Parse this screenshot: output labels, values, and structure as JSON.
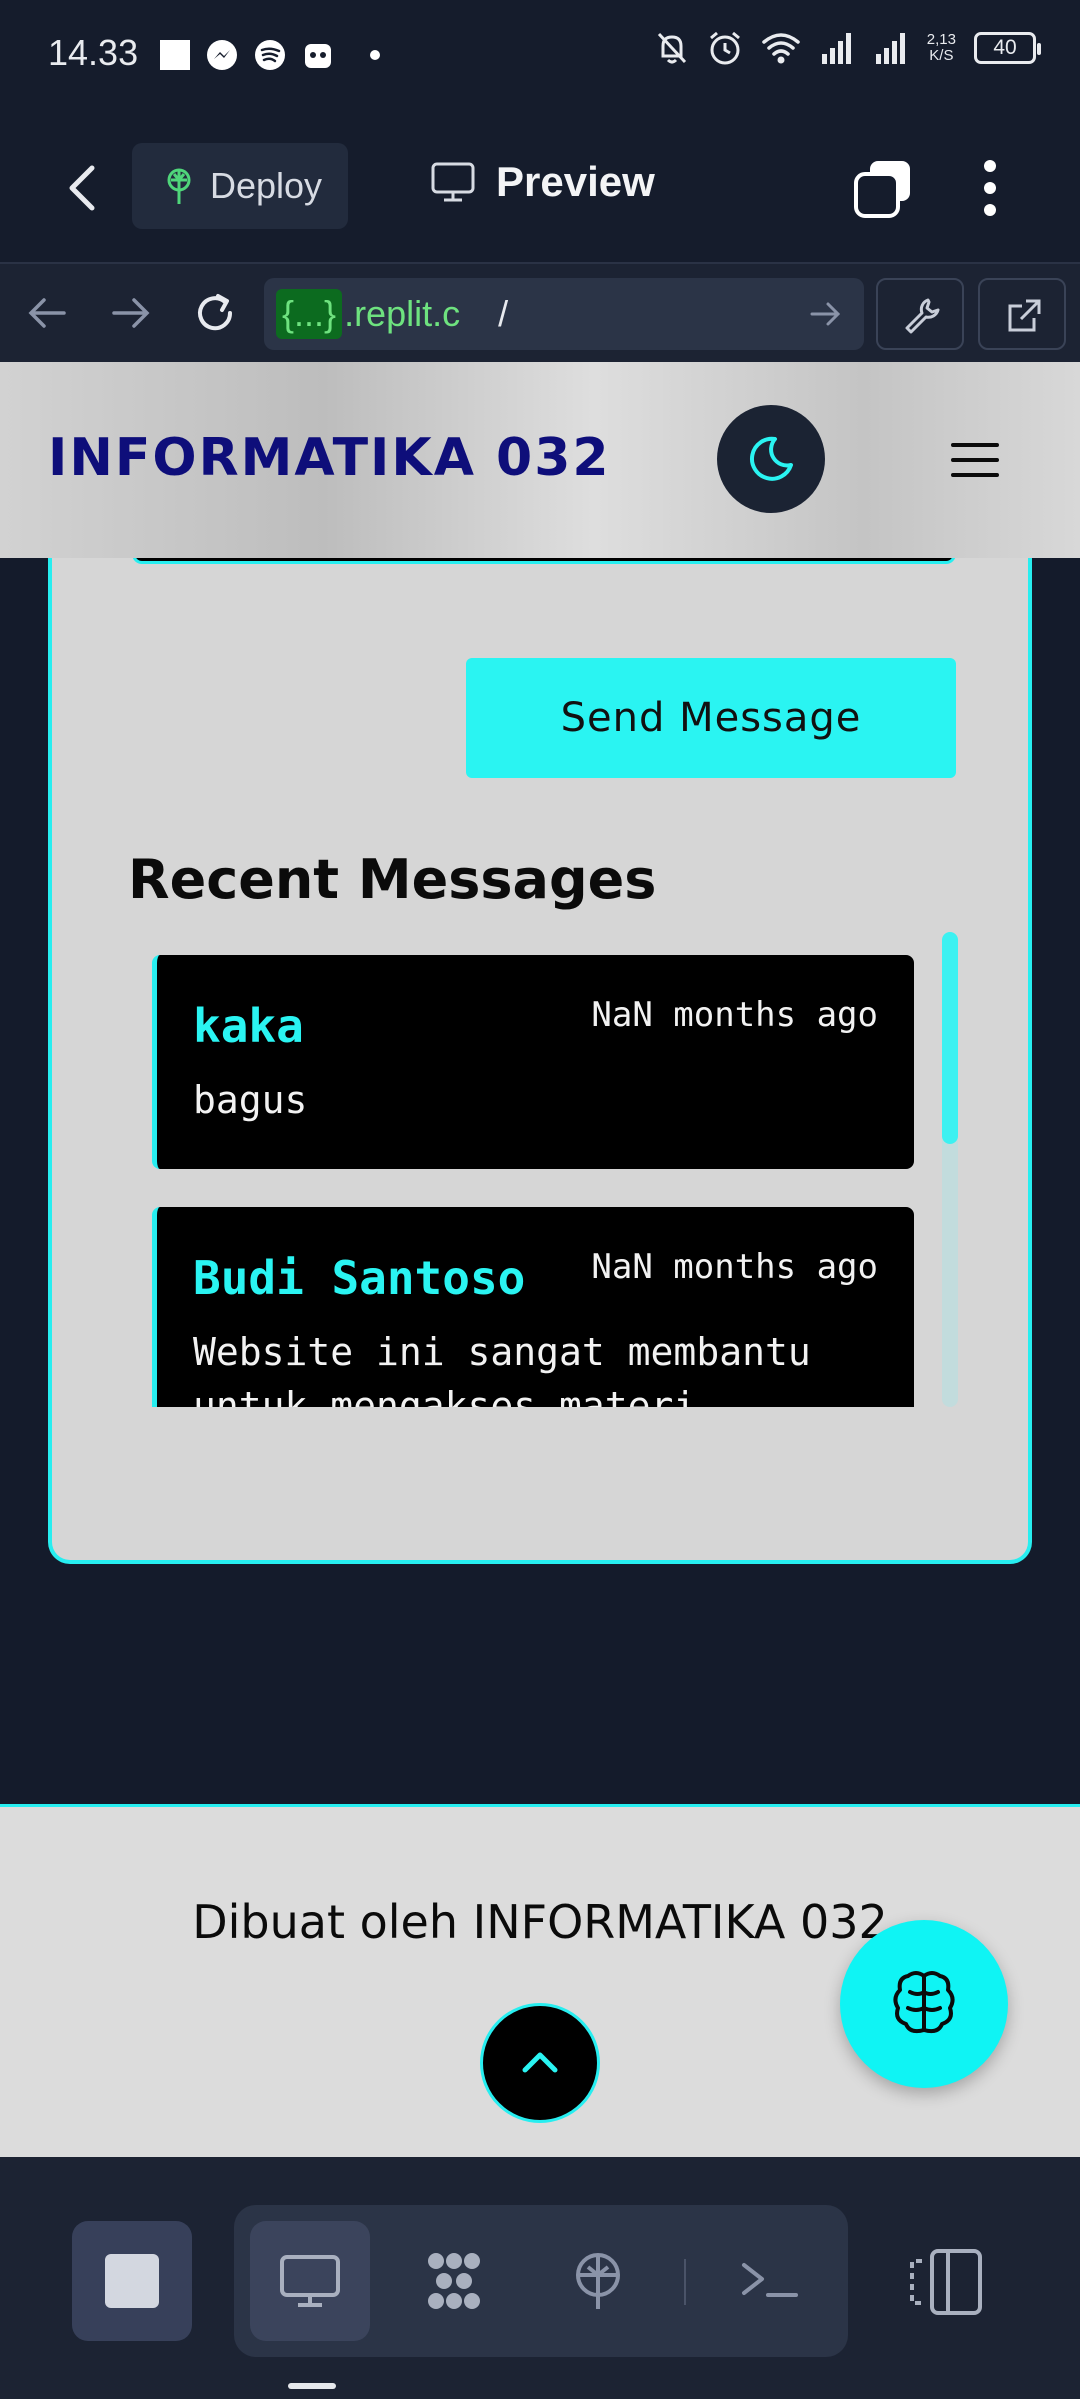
{
  "status_bar": {
    "time": "14.33",
    "network_speed_top": "2,13",
    "network_speed_unit": "K/S",
    "battery": "40"
  },
  "replit": {
    "deploy_label": "Deploy",
    "preview_label": "Preview",
    "url_chip": "{...}",
    "url_host": ".replit.c",
    "url_path": "/"
  },
  "site": {
    "brand": "INFORMATIKA 032",
    "send_button": "Send Message",
    "recent_title": "Recent Messages",
    "messages": [
      {
        "name": "kaka",
        "time": "NaN months ago",
        "text": "bagus"
      },
      {
        "name": "Budi Santoso",
        "time": "NaN months ago",
        "text": "Website ini sangat membantu untuk mengakses materi"
      }
    ],
    "footer_text": "Dibuat oleh INFORMATIKA 032"
  },
  "colors": {
    "accent": "#2af4f2",
    "brand": "#0e0e7a",
    "app_bg": "#151c2c"
  },
  "icons": {
    "deploy": "deploy-icon",
    "preview": "monitor-icon",
    "theme": "moon-icon",
    "menu": "hamburger-icon",
    "fab": "brain-icon",
    "scroll_top": "chevron-up-icon"
  }
}
